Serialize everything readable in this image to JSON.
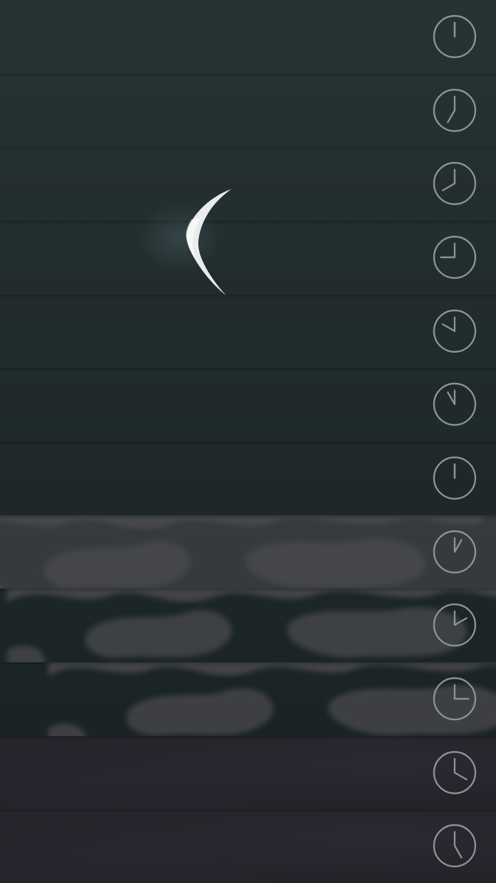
{
  "colors": {
    "sky_top": "#273234",
    "sky_bottom": "#172022",
    "cloud_gray": "#4a4a4f",
    "overcast": "#24232a",
    "clock_stroke": "#8c9496",
    "moon": "#e9ebec"
  },
  "weather": {
    "condition_icon": "crescent-moon-icon"
  },
  "hours": [
    {
      "id": "hour-1",
      "icon": "clock-icon",
      "hour_hand_angle_deg": 0,
      "sky": "clear"
    },
    {
      "id": "hour-2",
      "icon": "clock-icon",
      "hour_hand_angle_deg": 210,
      "sky": "clear"
    },
    {
      "id": "hour-3",
      "icon": "clock-icon",
      "hour_hand_angle_deg": 240,
      "sky": "clear"
    },
    {
      "id": "hour-4",
      "icon": "clock-icon",
      "hour_hand_angle_deg": 270,
      "sky": "clear"
    },
    {
      "id": "hour-5",
      "icon": "clock-icon",
      "hour_hand_angle_deg": 300,
      "sky": "clear"
    },
    {
      "id": "hour-6",
      "icon": "clock-icon",
      "hour_hand_angle_deg": 330,
      "sky": "clear"
    },
    {
      "id": "hour-7",
      "icon": "clock-icon",
      "hour_hand_angle_deg": 0,
      "sky": "clear"
    },
    {
      "id": "hour-8",
      "icon": "clock-icon",
      "hour_hand_angle_deg": 30,
      "sky": "cloudy"
    },
    {
      "id": "hour-9",
      "icon": "clock-icon",
      "hour_hand_angle_deg": 60,
      "sky": "cloudy"
    },
    {
      "id": "hour-10",
      "icon": "clock-icon",
      "hour_hand_angle_deg": 90,
      "sky": "cloudy"
    },
    {
      "id": "hour-11",
      "icon": "clock-icon",
      "hour_hand_angle_deg": 120,
      "sky": "overcast"
    },
    {
      "id": "hour-12",
      "icon": "clock-icon",
      "hour_hand_angle_deg": 150,
      "sky": "overcast"
    }
  ]
}
